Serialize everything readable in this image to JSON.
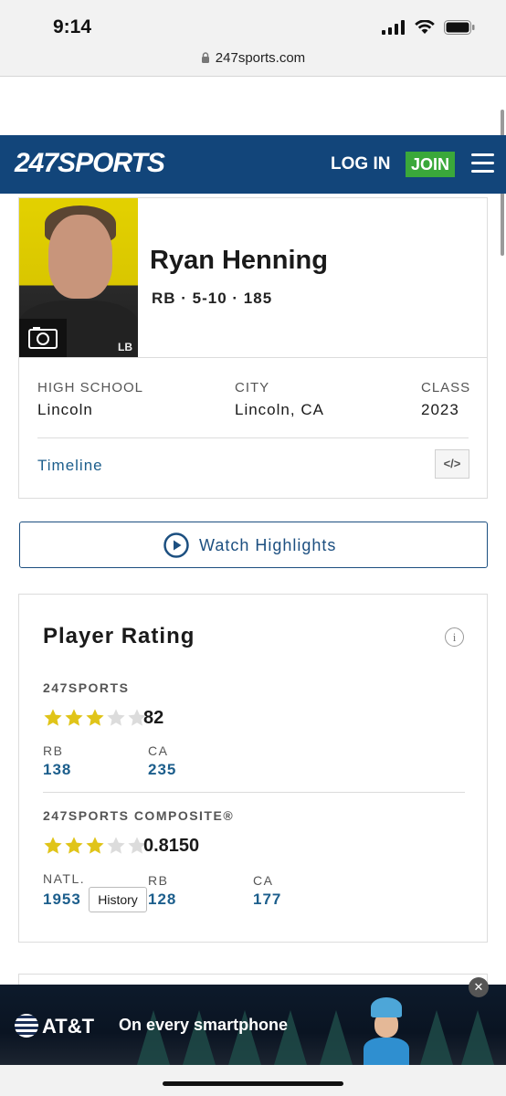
{
  "status_bar": {
    "time": "9:14"
  },
  "browser": {
    "url": "247sports.com"
  },
  "header": {
    "logo": "247SPORTS",
    "login": "LOG IN",
    "join": "JOIN"
  },
  "player": {
    "name": "Ryan Henning",
    "meta": "RB · 5-10 · 185",
    "photo_badge": "LB",
    "high_school_label": "HIGH SCHOOL",
    "high_school": "Lincoln",
    "city_label": "CITY",
    "city": "Lincoln, CA",
    "class_label": "CLASS",
    "class": "2023",
    "timeline": "Timeline",
    "embed": "</>"
  },
  "highlights": {
    "label": "Watch Highlights"
  },
  "rating": {
    "title": "Player Rating",
    "info": "i",
    "sports247": {
      "label": "247SPORTS",
      "stars": 3,
      "max_stars": 5,
      "score": "82",
      "rb_label": "RB",
      "rb_rank": "138",
      "ca_label": "CA",
      "ca_rank": "235"
    },
    "composite": {
      "label": "247SPORTS COMPOSITE®",
      "stars": 3,
      "max_stars": 5,
      "score": "0.8150",
      "natl_label": "NATL.",
      "natl_rank": "1953",
      "history": "History",
      "rb_label": "RB",
      "rb_rank": "128",
      "ca_label": "CA",
      "ca_rank": "177"
    }
  },
  "ad": {
    "brand": "AT&T",
    "text": "On every smartphone",
    "close": "✕"
  },
  "colors": {
    "header_bg": "#12457a",
    "join_bg": "#3aa83a",
    "link": "#1c5e8c",
    "star_on": "#e0c419",
    "star_off": "#dcdcdc"
  },
  "icons": [
    "lock-icon",
    "signal-icon",
    "wifi-icon",
    "battery-icon",
    "menu-icon",
    "camera-icon",
    "play-icon",
    "info-icon",
    "star-icon",
    "close-icon"
  ]
}
